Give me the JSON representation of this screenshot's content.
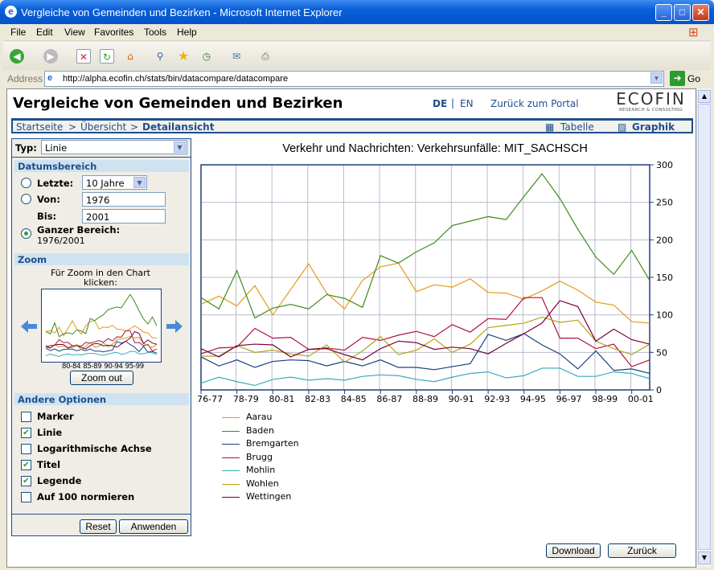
{
  "window": {
    "title": "Vergleiche von Gemeinden und Bezirken - Microsoft Internet Explorer"
  },
  "menu": [
    "File",
    "Edit",
    "View",
    "Favorites",
    "Tools",
    "Help"
  ],
  "address": {
    "label": "Address",
    "url": "http://alpha.ecofin.ch/stats/bin/datacompare/datacompare",
    "go": "Go"
  },
  "header": {
    "title": "Vergleiche von Gemeinden und Bezirken",
    "lang_de": "DE",
    "lang_sep": "|",
    "lang_en": "EN",
    "portal": "Zurück zum Portal",
    "logo": "ECOFIN",
    "logo_sub": "RESEARCH & CONSULTING"
  },
  "breadcrumb": {
    "home": "Startseite",
    "sep": ">",
    "overview": "Übersicht",
    "current": "Detailansicht",
    "table": "Tabelle",
    "graph": "Graphik"
  },
  "panel": {
    "type_label": "Typ:",
    "type_value": "Linie",
    "date_section": "Datumsbereich",
    "last_label": "Letzte:",
    "last_value": "10 Jahre",
    "from_label": "Von:",
    "from_value": "1976",
    "to_label": "Bis:",
    "to_value": "2001",
    "full_label": "Ganzer Bereich:",
    "full_value": "1976/2001",
    "selected_range": "full",
    "zoom_section": "Zoom",
    "zoom_hint": "Für Zoom in den Chart klicken:",
    "thumb_labels": [
      "80-84",
      "85-89",
      "90-94",
      "95-99"
    ],
    "zoom_out": "Zoom out",
    "options_section": "Andere Optionen",
    "options": [
      {
        "label": "Marker",
        "checked": false
      },
      {
        "label": "Linie",
        "checked": true
      },
      {
        "label": "Logarithmische Achse",
        "checked": false
      },
      {
        "label": "Titel",
        "checked": true
      },
      {
        "label": "Legende",
        "checked": true
      },
      {
        "label": "Auf 100 normieren",
        "checked": false
      }
    ],
    "reset": "Reset",
    "apply": "Anwenden"
  },
  "buttons": {
    "download": "Download",
    "back": "Zurück"
  },
  "chart_data": {
    "type": "line",
    "title": "Verkehr und Nachrichten: Verkehrsunfälle: MIT_SACHSCH",
    "x": [
      1976,
      1977,
      1978,
      1979,
      1980,
      1981,
      1982,
      1983,
      1984,
      1985,
      1986,
      1987,
      1988,
      1989,
      1990,
      1991,
      1992,
      1993,
      1994,
      1995,
      1996,
      1997,
      1998,
      1999,
      2000,
      2001
    ],
    "xtick_labels": [
      "76-77",
      "78-79",
      "80-81",
      "82-83",
      "84-85",
      "86-87",
      "88-89",
      "90-91",
      "92-93",
      "94-95",
      "96-97",
      "98-99",
      "00-01"
    ],
    "ylim": [
      0,
      300
    ],
    "yticks": [
      0,
      50,
      100,
      150,
      200,
      250,
      300
    ],
    "y_axis_side": "right",
    "grid": true,
    "legend": "bottom-left",
    "series": [
      {
        "name": "Aarau",
        "color": "#e39a1c",
        "values": [
          114,
          125,
          112,
          139,
          100,
          134,
          168,
          129,
          108,
          146,
          164,
          169,
          131,
          140,
          137,
          148,
          130,
          129,
          121,
          132,
          145,
          133,
          117,
          113,
          91,
          89
        ]
      },
      {
        "name": "Baden",
        "color": "#3c8c1c",
        "values": [
          123,
          108,
          159,
          96,
          109,
          114,
          108,
          127,
          122,
          110,
          179,
          169,
          184,
          196,
          219,
          225,
          231,
          227,
          258,
          288,
          255,
          214,
          177,
          154,
          186,
          146
        ]
      },
      {
        "name": "Bremgarten",
        "color": "#1b3f7a",
        "values": [
          44,
          32,
          40,
          30,
          38,
          40,
          39,
          32,
          38,
          32,
          40,
          30,
          30,
          27,
          31,
          35,
          74,
          66,
          75,
          60,
          48,
          28,
          52,
          26,
          28,
          22
        ]
      },
      {
        "name": "Brugg",
        "color": "#b0103f",
        "values": [
          48,
          56,
          57,
          82,
          69,
          70,
          54,
          56,
          53,
          70,
          66,
          73,
          78,
          71,
          87,
          77,
          95,
          94,
          123,
          123,
          69,
          69,
          55,
          61,
          31,
          40
        ]
      },
      {
        "name": "Mohlin",
        "color": "#3aaabb",
        "values": [
          9,
          17,
          11,
          6,
          14,
          17,
          13,
          15,
          13,
          18,
          20,
          19,
          14,
          11,
          17,
          22,
          24,
          16,
          19,
          29,
          29,
          18,
          18,
          24,
          22,
          15
        ]
      },
      {
        "name": "Wohlen",
        "color": "#b5a417",
        "values": [
          45,
          45,
          59,
          50,
          53,
          48,
          45,
          60,
          37,
          52,
          71,
          47,
          53,
          68,
          50,
          61,
          83,
          86,
          89,
          97,
          90,
          93,
          65,
          55,
          47,
          61
        ]
      },
      {
        "name": "Wettingen",
        "color": "#7a0038",
        "values": [
          55,
          44,
          59,
          61,
          60,
          44,
          54,
          55,
          47,
          40,
          55,
          65,
          63,
          54,
          57,
          55,
          48,
          62,
          75,
          89,
          119,
          111,
          65,
          81,
          67,
          61
        ]
      }
    ]
  }
}
